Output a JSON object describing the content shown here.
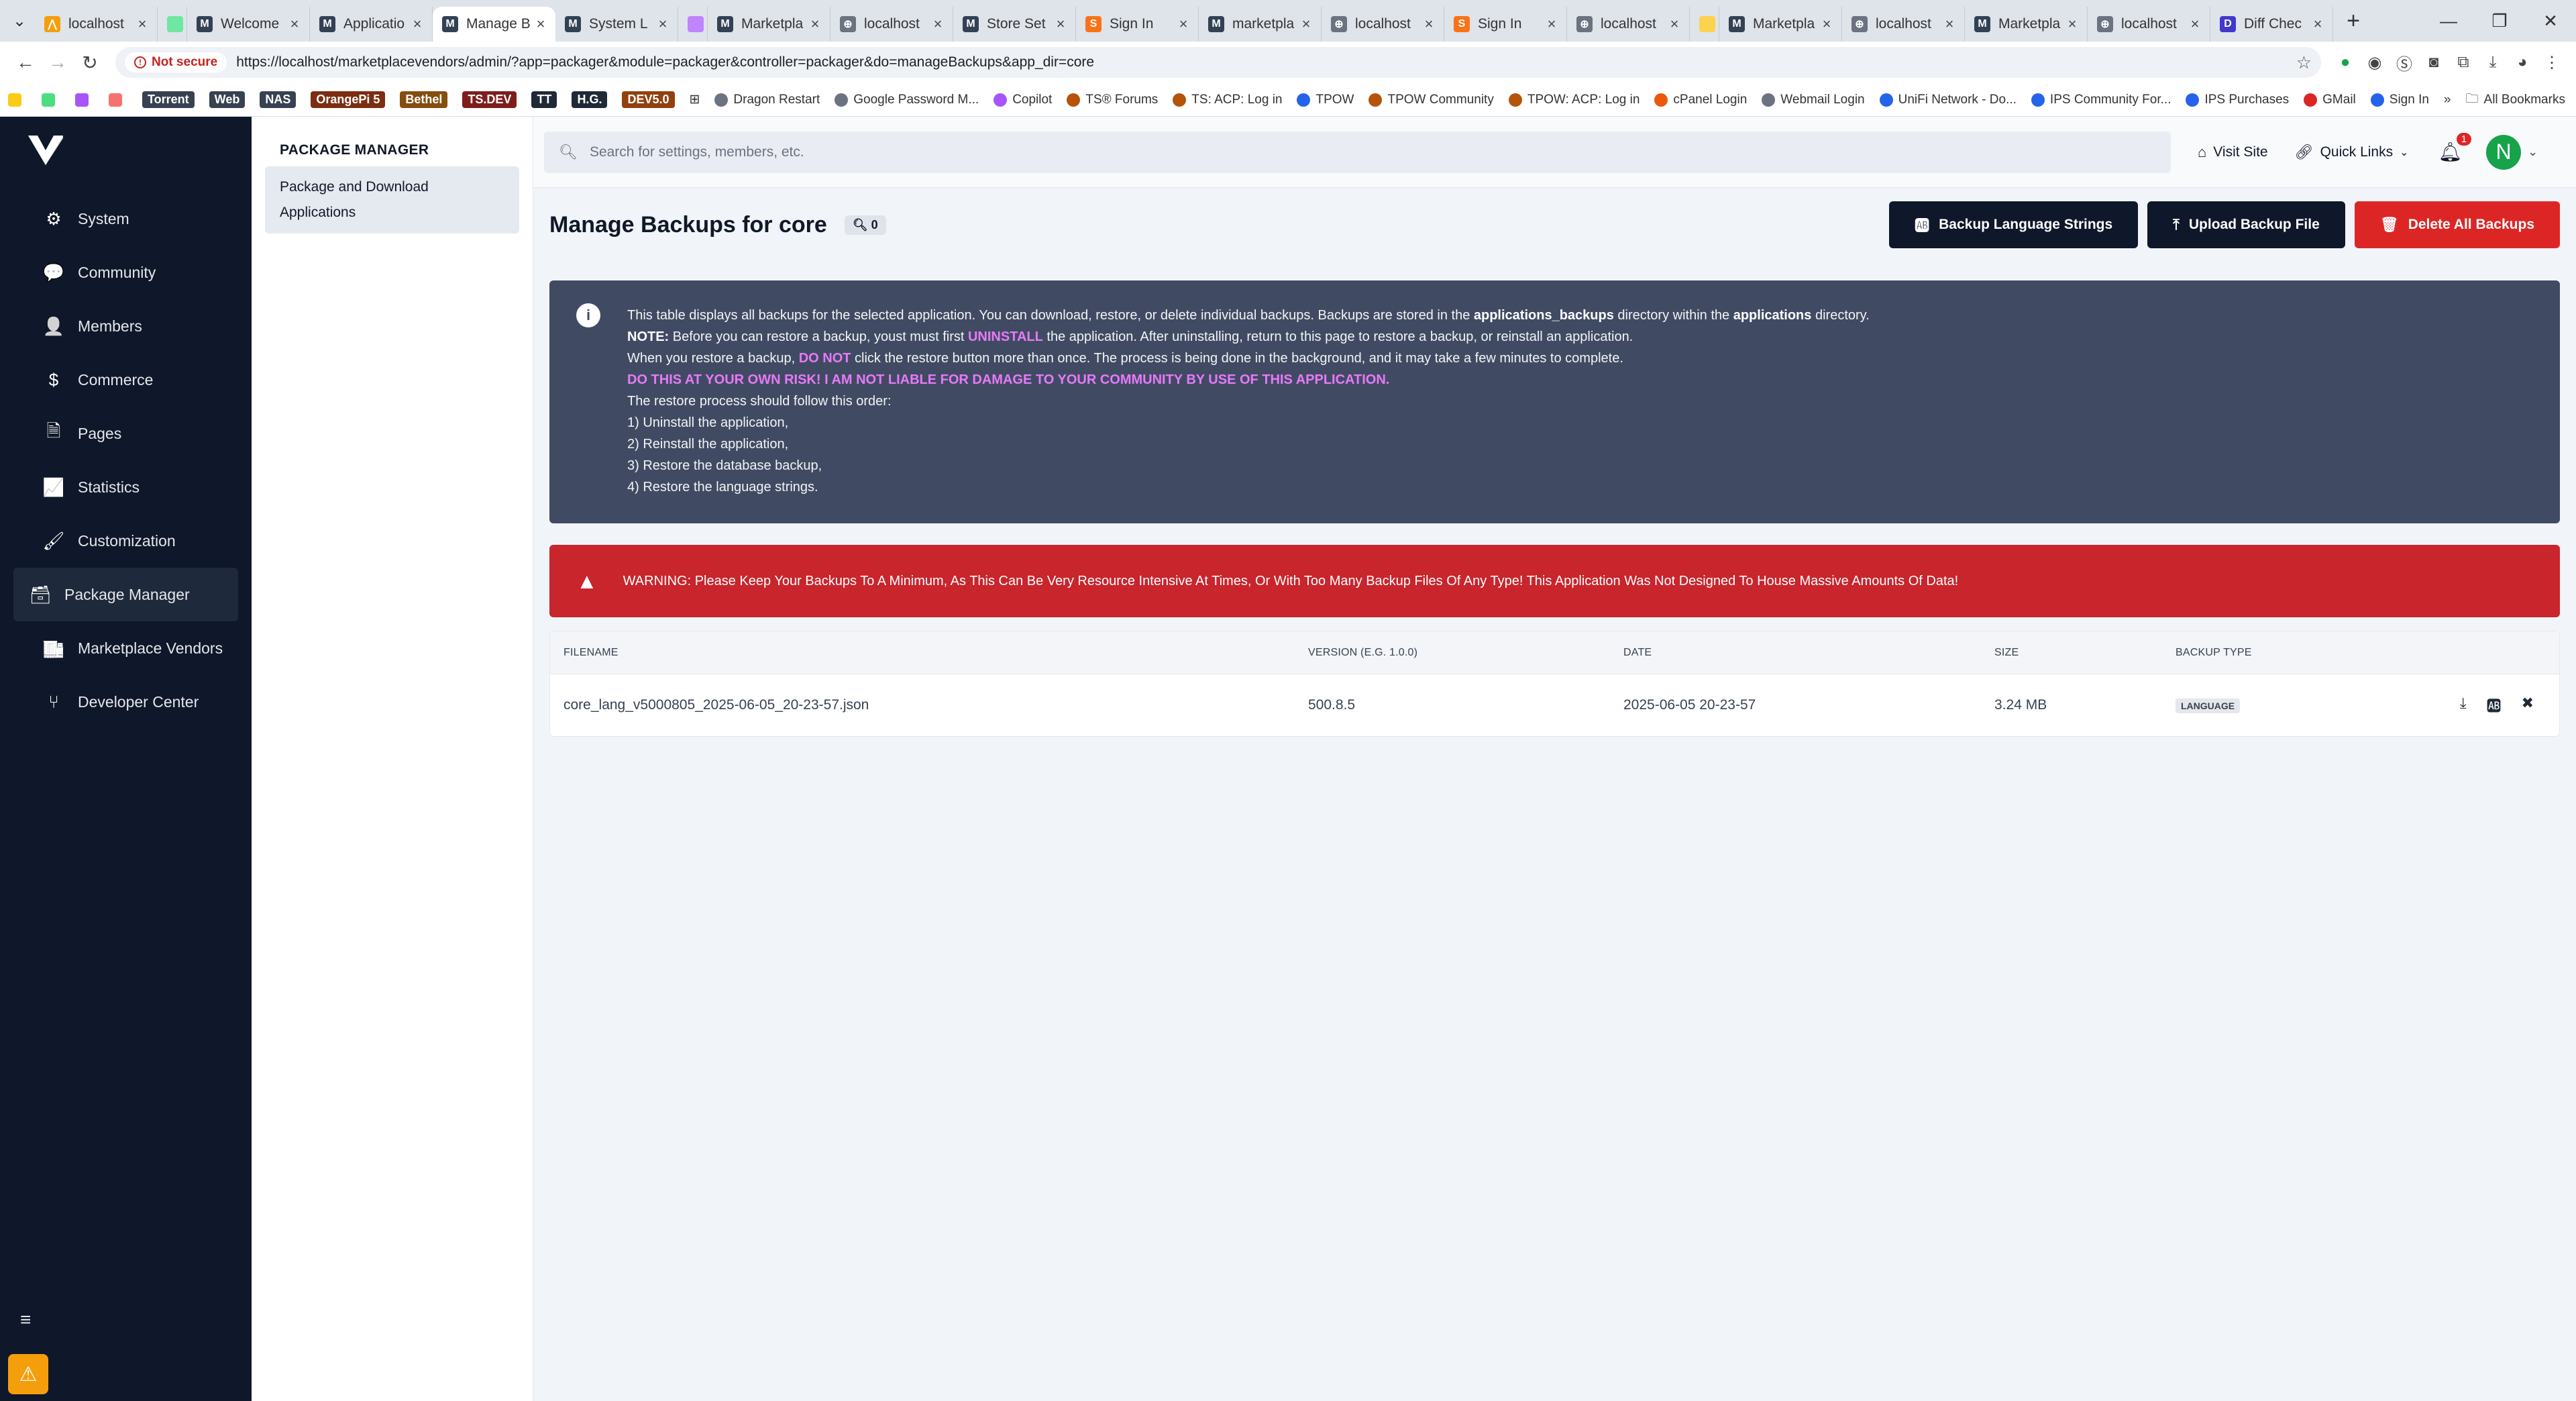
{
  "browser": {
    "tabs": [
      {
        "title": "localhost",
        "color": "#f59e0b",
        "glyph": "⋀"
      },
      {
        "title": "",
        "color": "#6ee7a0",
        "glyph": ""
      },
      {
        "title": "Welcome",
        "color": "#334155",
        "glyph": "M"
      },
      {
        "title": "Applicatio",
        "color": "#334155",
        "glyph": "M"
      },
      {
        "title": "Manage B",
        "color": "#334155",
        "glyph": "M",
        "active": true
      },
      {
        "title": "System L",
        "color": "#334155",
        "glyph": "M"
      },
      {
        "title": "",
        "color": "#c084fc",
        "glyph": ""
      },
      {
        "title": "Marketpla",
        "color": "#334155",
        "glyph": "M"
      },
      {
        "title": "localhost",
        "color": "#6b7280",
        "glyph": "⊕"
      },
      {
        "title": "Store Set",
        "color": "#334155",
        "glyph": "M"
      },
      {
        "title": "Sign In",
        "color": "#f97316",
        "glyph": "S"
      },
      {
        "title": "marketpla",
        "color": "#334155",
        "glyph": "M"
      },
      {
        "title": "localhost",
        "color": "#6b7280",
        "glyph": "⊕"
      },
      {
        "title": "Sign In",
        "color": "#f97316",
        "glyph": "S"
      },
      {
        "title": "localhost",
        "color": "#6b7280",
        "glyph": "⊕"
      },
      {
        "title": "",
        "color": "#fcd34d",
        "glyph": ""
      },
      {
        "title": "Marketpla",
        "color": "#334155",
        "glyph": "M"
      },
      {
        "title": "localhost",
        "color": "#6b7280",
        "glyph": "⊕"
      },
      {
        "title": "Marketpla",
        "color": "#334155",
        "glyph": "M"
      },
      {
        "title": "localhost",
        "color": "#6b7280",
        "glyph": "⊕"
      },
      {
        "title": "Diff Chec",
        "color": "#4338ca",
        "glyph": "D"
      }
    ],
    "not_secure_label": "Not secure",
    "url": "https://localhost/marketplacevendors/admin/?app=packager&module=packager&controller=packager&do=manageBackups&app_dir=core",
    "bookmarks": [
      {
        "label": "Torrent",
        "type": "tag",
        "color": "#374151"
      },
      {
        "label": "Web",
        "type": "tag",
        "color": "#374151"
      },
      {
        "label": "NAS",
        "type": "tag",
        "color": "#374151"
      },
      {
        "label": "OrangePi 5",
        "type": "tag",
        "color": "#7c2d12"
      },
      {
        "label": "Bethel",
        "type": "tag",
        "color": "#854d0e"
      },
      {
        "label": "TS.DEV",
        "type": "tag",
        "color": "#7f1d1d"
      },
      {
        "label": "TT",
        "type": "tag",
        "color": "#1f2937"
      },
      {
        "label": "H.G.",
        "type": "tag",
        "color": "#1f2937"
      },
      {
        "label": "DEV5.0",
        "type": "tag",
        "color": "#92400e"
      },
      {
        "label": "Dragon Restart",
        "type": "link",
        "color": "#6b7280"
      },
      {
        "label": "Google Password M...",
        "type": "link",
        "color": "#6b7280"
      },
      {
        "label": "Copilot",
        "type": "link",
        "color": "#a855f7"
      },
      {
        "label": "TS® Forums",
        "type": "link",
        "color": "#b45309"
      },
      {
        "label": "TS: ACP: Log in",
        "type": "link",
        "color": "#b45309"
      },
      {
        "label": "TPOW",
        "type": "link",
        "color": "#2563eb"
      },
      {
        "label": "TPOW Community",
        "type": "link",
        "color": "#b45309"
      },
      {
        "label": "TPOW: ACP: Log in",
        "type": "link",
        "color": "#b45309"
      },
      {
        "label": "cPanel Login",
        "type": "link",
        "color": "#ea580c"
      },
      {
        "label": "Webmail Login",
        "type": "link",
        "color": "#6b7280"
      },
      {
        "label": "UniFi Network - Do...",
        "type": "link",
        "color": "#2563eb"
      },
      {
        "label": "IPS Community For...",
        "type": "link",
        "color": "#2563eb"
      },
      {
        "label": "IPS Purchases",
        "type": "link",
        "color": "#2563eb"
      },
      {
        "label": "GMail",
        "type": "link",
        "color": "#dc2626"
      },
      {
        "label": "Sign In",
        "type": "link",
        "color": "#2563eb"
      }
    ],
    "all_bookmarks_label": "All Bookmarks"
  },
  "sidebar": {
    "items": [
      {
        "label": "System",
        "icon": "gears-icon",
        "glyph": "⚙"
      },
      {
        "label": "Community",
        "icon": "comments-icon",
        "glyph": "💬"
      },
      {
        "label": "Members",
        "icon": "user-icon",
        "glyph": "👤"
      },
      {
        "label": "Commerce",
        "icon": "dollar-icon",
        "glyph": "$"
      },
      {
        "label": "Pages",
        "icon": "page-icon",
        "glyph": "🗎"
      },
      {
        "label": "Statistics",
        "icon": "chart-line-icon",
        "glyph": "📈"
      },
      {
        "label": "Customization",
        "icon": "paintbrush-icon",
        "glyph": "🖌"
      },
      {
        "label": "Package Manager",
        "icon": "archive-icon",
        "glyph": "🗃",
        "active": true
      },
      {
        "label": "Marketplace Vendors",
        "icon": "store-icon",
        "glyph": "🏬"
      },
      {
        "label": "Developer Center",
        "icon": "code-branch-icon",
        "glyph": "⑂"
      }
    ]
  },
  "subnav": {
    "title": "PACKAGE MANAGER",
    "item_label": "Package and Download Applications"
  },
  "topbar": {
    "search_placeholder": "Search for settings, members, etc.",
    "visit_site": "Visit Site",
    "quick_links": "Quick Links",
    "notification_count": "1",
    "avatar_initial": "N"
  },
  "page": {
    "title": "Manage Backups for core",
    "count": "0",
    "buttons": {
      "backup_lang": "Backup Language Strings",
      "upload": "Upload Backup File",
      "delete_all": "Delete All Backups"
    }
  },
  "info": {
    "line1_a": "This table displays all backups for the selected application. You can download, restore, or delete individual backups. Backups are stored in the ",
    "line1_b": "applications_backups",
    "line1_c": " directory within the ",
    "line1_d": "applications",
    "line1_e": " directory.",
    "line2_a": "NOTE:",
    "line2_b": " Before you can restore a backup, youst must first ",
    "line2_c": "UNINSTALL",
    "line2_d": " the application. After uninstalling, return to this page to restore a backup, or reinstall an application.",
    "line3_a": "When you restore a backup, ",
    "line3_b": "DO NOT",
    "line3_c": " click the restore button more than once. The process is being done in the background, and it may take a few minutes to complete.",
    "line4": "DO THIS AT YOUR OWN RISK! I AM NOT LIABLE FOR DAMAGE TO YOUR COMMUNITY BY USE OF THIS APPLICATION.",
    "line5": "The restore process should follow this order:",
    "steps": [
      "1) Uninstall the application,",
      "2) Reinstall the application,",
      "3) Restore the database backup,",
      "4) Restore the language strings."
    ]
  },
  "warning": "WARNING: Please Keep Your Backups To A Minimum, As This Can Be Very Resource Intensive At Times, Or With Too Many Backup Files Of Any Type! This Application Was Not Designed To House Massive Amounts Of Data!",
  "table": {
    "headers": [
      "FILENAME",
      "VERSION (E.G. 1.0.0)",
      "DATE",
      "SIZE",
      "BACKUP TYPE"
    ],
    "rows": [
      {
        "filename": "core_lang_v5000805_2025-06-05_20-23-57.json",
        "version": "500.8.5",
        "date": "2025-06-05 20-23-57",
        "size": "3.24 MB",
        "type": "LANGUAGE"
      }
    ]
  },
  "colors": {
    "sidebar_bg": "#0f172a",
    "primary_button": "#0f172a",
    "danger": "#dc2626",
    "info_bg": "#404b63",
    "highlight_pink": "#e879f9"
  }
}
